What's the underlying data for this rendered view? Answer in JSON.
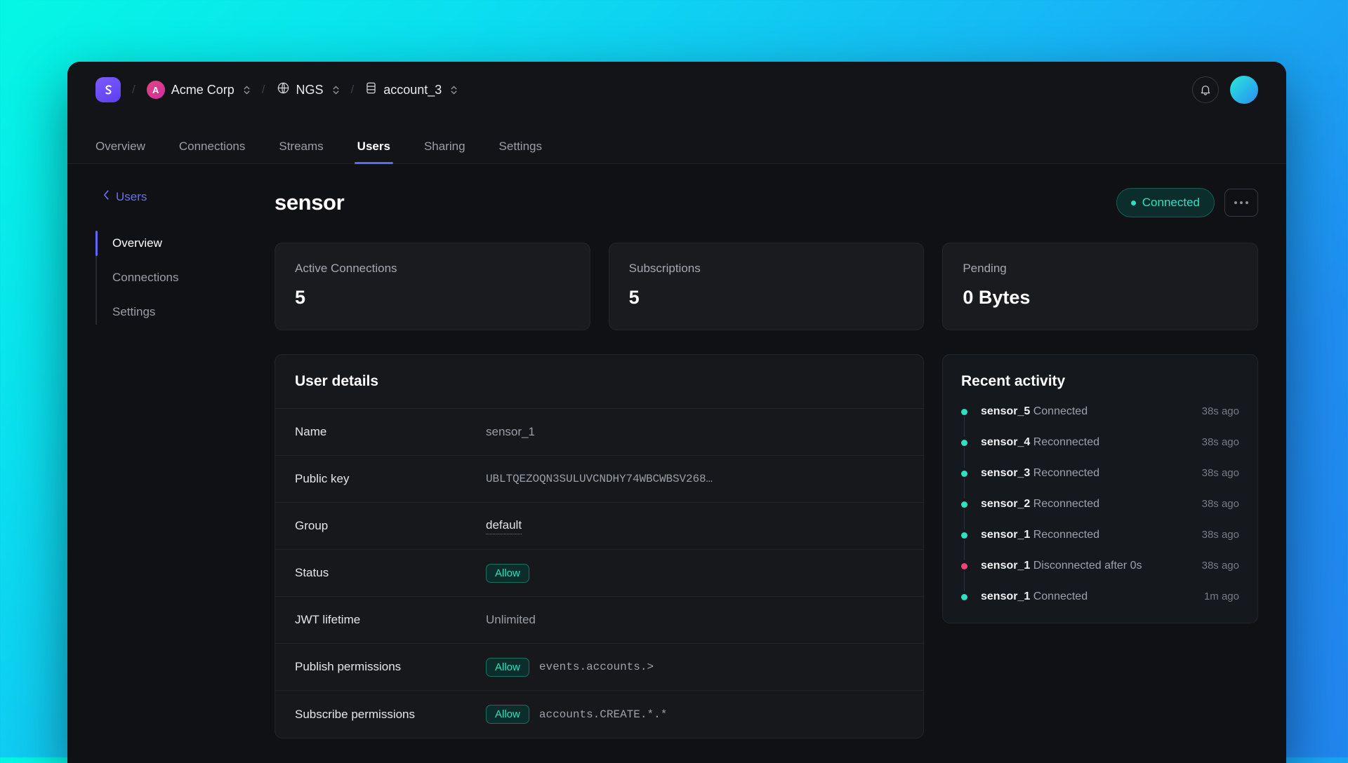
{
  "brand": {
    "logo_icon": "app-logo-swirl",
    "accent": "#6366f1"
  },
  "breadcrumb": {
    "org": {
      "label": "Acme Corp",
      "avatar_letter": "A",
      "icon": "org-avatar"
    },
    "system": {
      "label": "NGS",
      "icon": "globe-icon"
    },
    "account": {
      "label": "account_3",
      "icon": "database-icon"
    },
    "separator": "/"
  },
  "topbar": {
    "bell_icon": "bell-icon",
    "avatar_icon": "user-avatar"
  },
  "tabs": [
    {
      "label": "Overview",
      "active": false
    },
    {
      "label": "Connections",
      "active": false
    },
    {
      "label": "Streams",
      "active": false
    },
    {
      "label": "Users",
      "active": true
    },
    {
      "label": "Sharing",
      "active": false
    },
    {
      "label": "Settings",
      "active": false
    }
  ],
  "back_link": {
    "label": "Users",
    "icon": "chevron-left-icon"
  },
  "sidenav": [
    {
      "label": "Overview",
      "active": true
    },
    {
      "label": "Connections",
      "active": false
    },
    {
      "label": "Settings",
      "active": false
    }
  ],
  "header": {
    "title": "sensor",
    "status": {
      "label": "Connected",
      "color": "#2ee0c0"
    },
    "menu_icon": "kebab-menu-icon"
  },
  "stats": [
    {
      "label": "Active Connections",
      "value": "5"
    },
    {
      "label": "Subscriptions",
      "value": "5"
    },
    {
      "label": "Pending",
      "value": "0 Bytes"
    }
  ],
  "details": {
    "title": "User details",
    "rows": [
      {
        "key": "Name",
        "value": "sensor_1",
        "style": "plain"
      },
      {
        "key": "Public key",
        "value": "UBLTQEZOQN3SULUVCNDHY74WBCWBSV268…",
        "style": "mono"
      },
      {
        "key": "Group",
        "value": "default",
        "style": "dotted"
      },
      {
        "key": "Status",
        "badge": "Allow",
        "value": "",
        "style": "badge"
      },
      {
        "key": "JWT lifetime",
        "value": "Unlimited",
        "style": "plain"
      },
      {
        "key": "Publish permissions",
        "badge": "Allow",
        "value": "events.accounts.>",
        "style": "badge-subject"
      },
      {
        "key": "Subscribe permissions",
        "badge": "Allow",
        "value": "accounts.CREATE.*.*",
        "style": "badge-subject"
      }
    ]
  },
  "activity": {
    "title": "Recent activity",
    "items": [
      {
        "subject": "sensor_5",
        "event": "Connected",
        "time": "38s ago",
        "status": "ok"
      },
      {
        "subject": "sensor_4",
        "event": "Reconnected",
        "time": "38s ago",
        "status": "ok"
      },
      {
        "subject": "sensor_3",
        "event": "Reconnected",
        "time": "38s ago",
        "status": "ok"
      },
      {
        "subject": "sensor_2",
        "event": "Reconnected",
        "time": "38s ago",
        "status": "ok"
      },
      {
        "subject": "sensor_1",
        "event": "Reconnected",
        "time": "38s ago",
        "status": "ok"
      },
      {
        "subject": "sensor_1",
        "event": "Disconnected after 0s",
        "time": "38s ago",
        "status": "error"
      },
      {
        "subject": "sensor_1",
        "event": "Connected",
        "time": "1m ago",
        "status": "ok"
      }
    ],
    "colors": {
      "ok": "#2ee0c0",
      "error": "#f0437a"
    }
  }
}
